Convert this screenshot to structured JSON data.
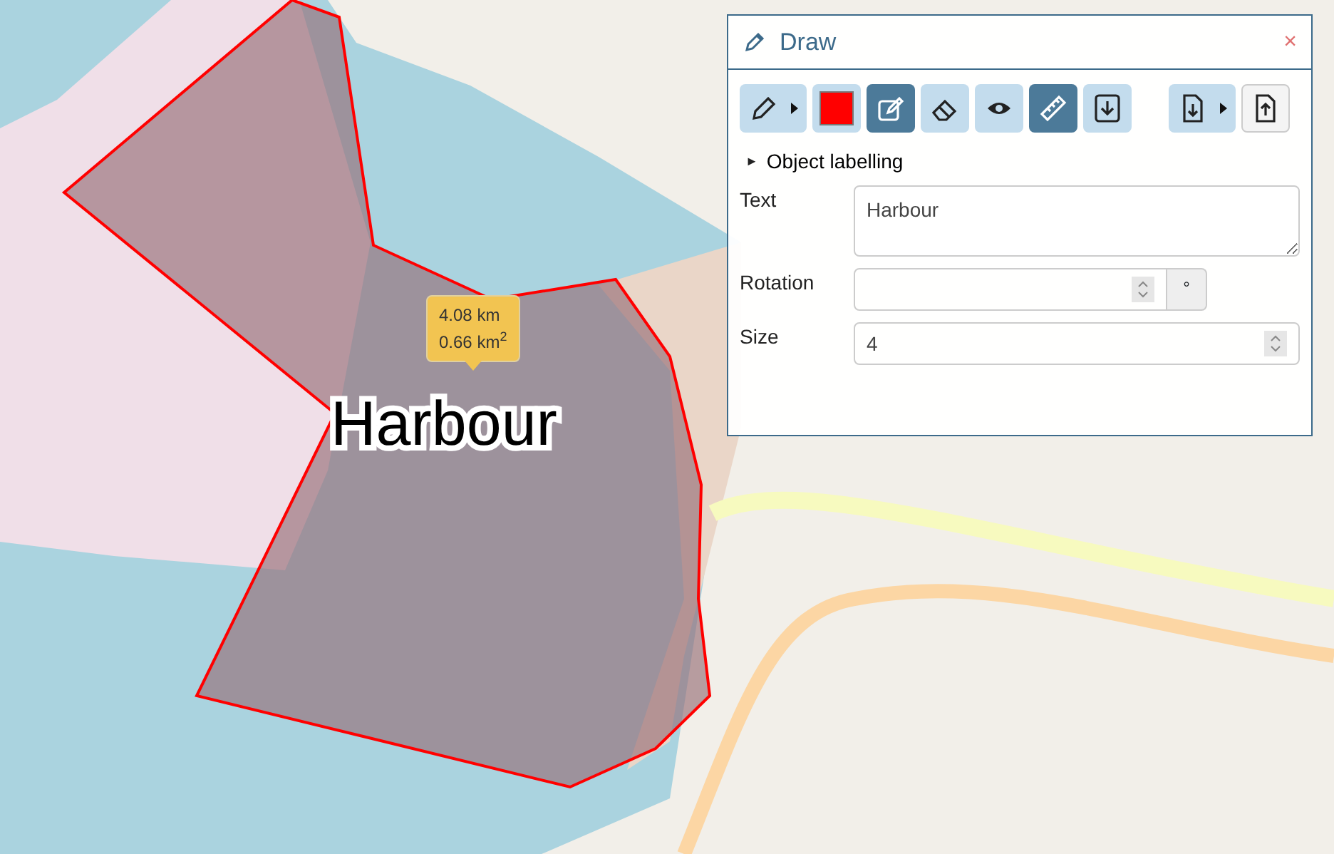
{
  "map": {
    "shape_label": "Harbour",
    "measurement": {
      "length": "4.08 km",
      "area_value": "0.66 km",
      "area_unit_power": "2"
    }
  },
  "panel": {
    "title": "Draw",
    "close": "×",
    "toolbar": [
      {
        "kind": "pencil-split",
        "active": false
      },
      {
        "kind": "color",
        "active": false,
        "color": "#ff0000"
      },
      {
        "kind": "edit",
        "active": true
      },
      {
        "kind": "eraser",
        "active": false
      },
      {
        "kind": "eye",
        "active": false
      },
      {
        "kind": "ruler",
        "active": true
      },
      {
        "kind": "import",
        "active": false
      },
      {
        "kind": "download-split",
        "active": false
      },
      {
        "kind": "upload",
        "active": false
      }
    ],
    "section": {
      "marker": "►",
      "title": "Object labelling",
      "expanded": true
    },
    "fields": [
      {
        "kind": "textarea",
        "label": "Text",
        "value": "Harbour"
      },
      {
        "kind": "number-unit",
        "label": "Rotation",
        "unit": "°"
      },
      {
        "kind": "number",
        "label": "Size",
        "value": "4"
      }
    ]
  }
}
